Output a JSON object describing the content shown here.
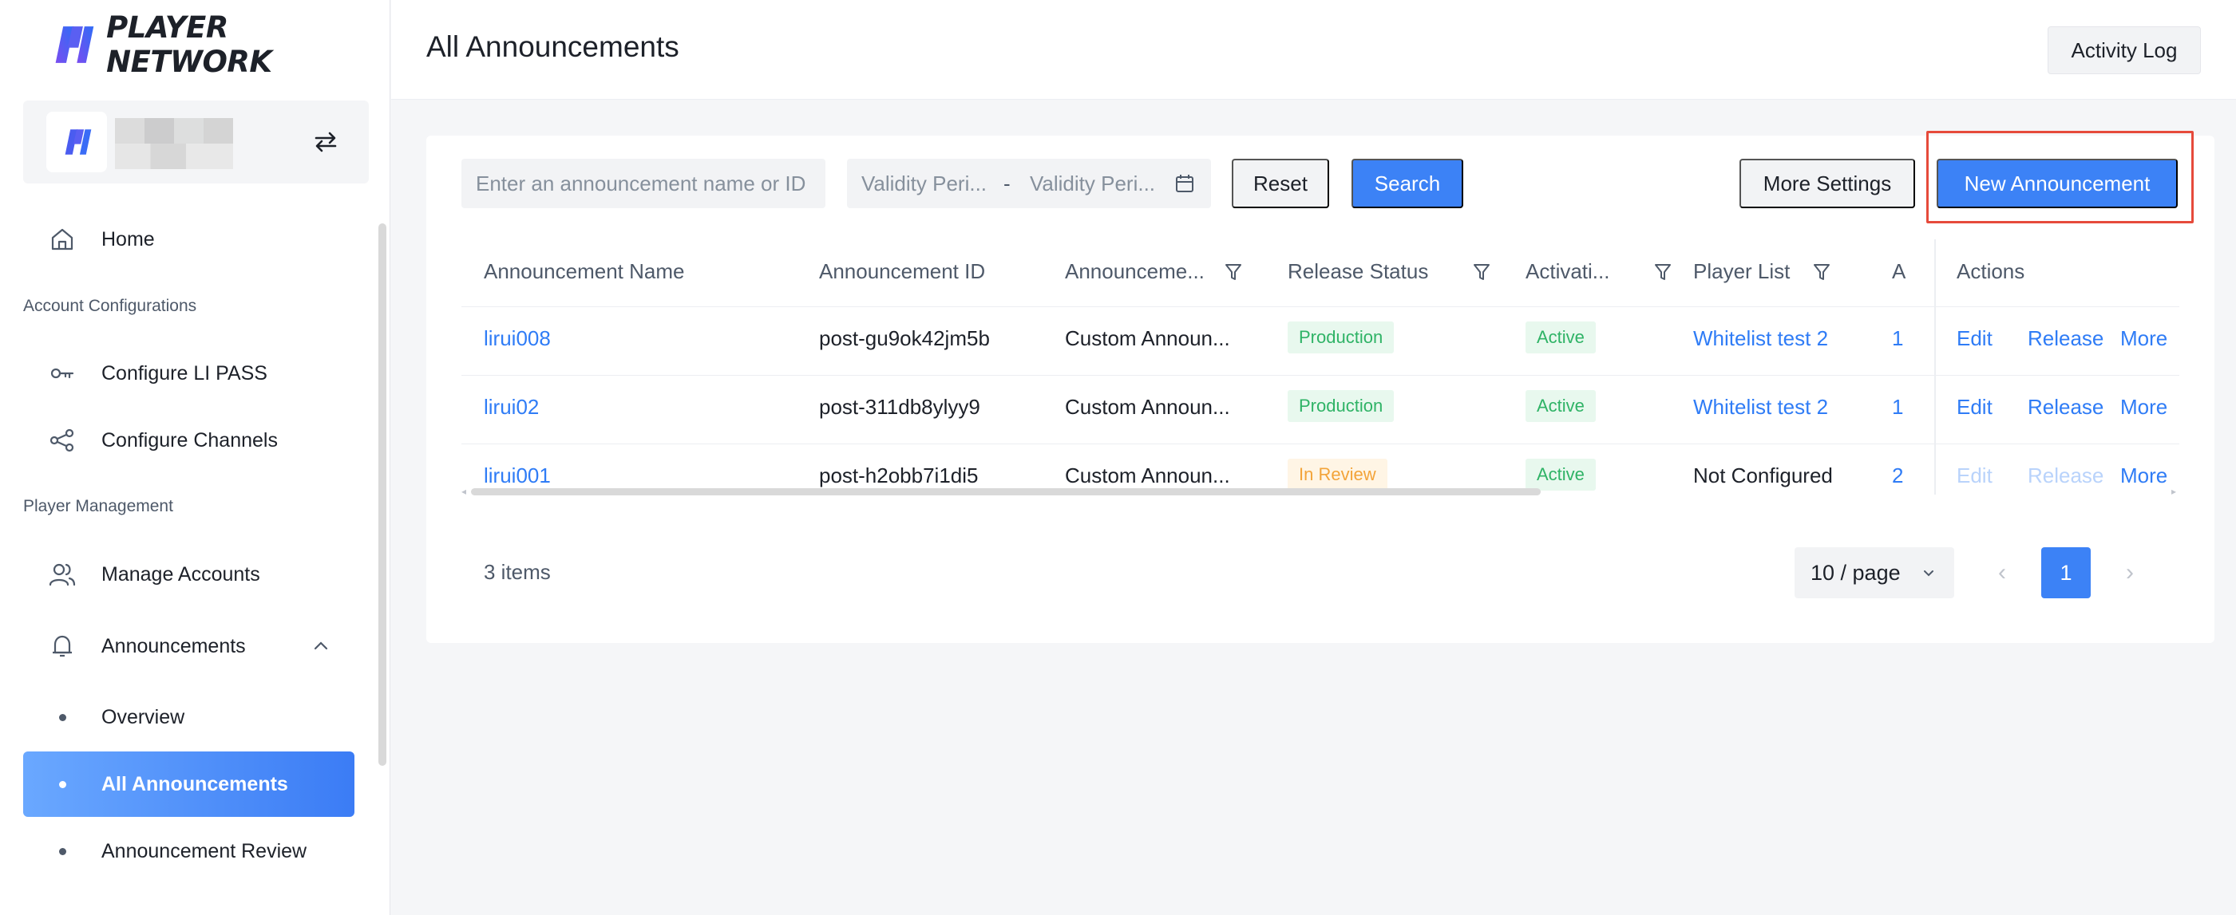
{
  "brand": {
    "name": "PLAYER NETWORK"
  },
  "sidebar": {
    "sections": {
      "account_config": "Account Configurations",
      "player_mgmt": "Player Management"
    },
    "items": {
      "home": "Home",
      "li_pass": "Configure LI PASS",
      "channels": "Configure Channels",
      "accounts": "Manage Accounts",
      "announcements": "Announcements",
      "overview": "Overview",
      "all_announcements": "All Announcements",
      "review": "Announcement Review"
    }
  },
  "header": {
    "title": "All Announcements",
    "activity_log": "Activity Log"
  },
  "filters": {
    "search_placeholder": "Enter an announcement name or ID",
    "date_start_placeholder": "Validity Peri...",
    "date_separator": "-",
    "date_end_placeholder": "Validity Peri...",
    "reset": "Reset",
    "search": "Search",
    "more_settings": "More Settings",
    "new_announcement": "New Announcement"
  },
  "table": {
    "columns": {
      "name": "Announcement Name",
      "id": "Announcement ID",
      "type": "Announceme...",
      "status": "Release Status",
      "activation": "Activati...",
      "player_list": "Player List",
      "partial": "A",
      "actions": "Actions"
    },
    "rows": [
      {
        "name": "lirui008",
        "id": "post-gu9ok42jm5b",
        "type": "Custom Announ...",
        "status": "Production",
        "activation": "Active",
        "player_list": "Whitelist test 2",
        "partial": "1",
        "edit": "Edit",
        "release": "Release",
        "more": "More"
      },
      {
        "name": "lirui02",
        "id": "post-311db8ylyy9",
        "type": "Custom Announ...",
        "status": "Production",
        "activation": "Active",
        "player_list": "Whitelist test 2",
        "partial": "1",
        "edit": "Edit",
        "release": "Release",
        "more": "More"
      },
      {
        "name": "lirui001",
        "id": "post-h2obb7i1di5",
        "type": "Custom Announ...",
        "status": "In Review",
        "activation": "Active",
        "player_list": "Not Configured",
        "partial": "2",
        "edit": "Edit",
        "release": "Release",
        "more": "More"
      }
    ]
  },
  "pagination": {
    "total": "3 items",
    "page_size": "10 / page",
    "current": "1"
  },
  "colors": {
    "primary": "#3c82f6",
    "success": "#2fb366",
    "warning": "#f3a43a",
    "highlight": "#e64a3b"
  },
  "icons": {
    "home": "home-icon",
    "key": "key-icon",
    "channels": "share-nodes-icon",
    "accounts": "users-icon",
    "bell": "bell-icon",
    "switch": "switch-arrows-icon",
    "calendar": "calendar-icon",
    "filter": "filter-icon"
  }
}
